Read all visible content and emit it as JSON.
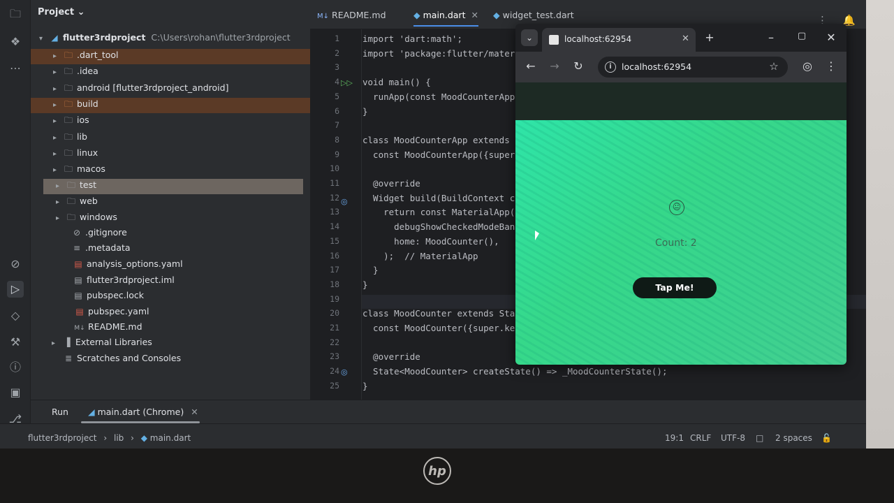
{
  "project_panel": {
    "title": "Project",
    "root": {
      "name": "flutter3rdproject",
      "path": "C:\\Users\\rohan\\flutter3rdproject"
    },
    "items": [
      {
        "label": ".dart_tool",
        "icon": "folder-excluded-icon"
      },
      {
        "label": ".idea",
        "icon": "folder-icon"
      },
      {
        "label": "android [flutter3rdproject_android]",
        "icon": "folder-icon"
      },
      {
        "label": "build",
        "icon": "folder-excluded-icon"
      },
      {
        "label": "ios",
        "icon": "folder-icon"
      },
      {
        "label": "lib",
        "icon": "folder-icon"
      },
      {
        "label": "linux",
        "icon": "folder-icon"
      },
      {
        "label": "macos",
        "icon": "folder-icon"
      },
      {
        "label": "test",
        "icon": "folder-icon"
      },
      {
        "label": "web",
        "icon": "folder-icon"
      },
      {
        "label": "windows",
        "icon": "folder-icon"
      },
      {
        "label": ".gitignore",
        "icon": "gitignore-icon"
      },
      {
        "label": ".metadata",
        "icon": "file-icon"
      },
      {
        "label": "analysis_options.yaml",
        "icon": "yaml-icon"
      },
      {
        "label": "flutter3rdproject.iml",
        "icon": "iml-icon"
      },
      {
        "label": "pubspec.lock",
        "icon": "file-icon"
      },
      {
        "label": "pubspec.yaml",
        "icon": "yaml-icon"
      },
      {
        "label": "README.md",
        "icon": "markdown-icon"
      },
      {
        "label": "External Libraries",
        "icon": "library-icon"
      },
      {
        "label": "Scratches and Consoles",
        "icon": "scratches-icon"
      }
    ]
  },
  "editor": {
    "tabs": [
      {
        "label": "README.md",
        "icon": "M↓"
      },
      {
        "label": "main.dart",
        "active": true
      },
      {
        "label": "widget_test.dart"
      }
    ],
    "line_numbers": [
      "1",
      "2",
      "3",
      "4",
      "5",
      "6",
      "7",
      "8",
      "9",
      "10",
      "11",
      "12",
      "13",
      "14",
      "15",
      "16",
      "17",
      "18",
      "19",
      "20",
      "21",
      "22",
      "23",
      "24",
      "25"
    ],
    "lines": [
      "import 'dart:math';",
      "import 'package:flutter/mater",
      "",
      "void main() {",
      "  runApp(const MoodCounterApp",
      "}",
      "",
      "class MoodCounterApp extends",
      "  const MoodCounterApp({super",
      "",
      "  @override",
      "  Widget build(BuildContext c",
      "    return const MaterialApp(",
      "      debugShowCheckedModeBan",
      "      home: MoodCounter(),",
      "    );  // MaterialApp",
      "  }",
      "}",
      "",
      "class MoodCounter extends Sta",
      "  const MoodCounter({super.ke",
      "",
      "  @override",
      "  State<MoodCounter> createState() => _MoodCounterState();",
      "}"
    ]
  },
  "run_bar": {
    "tool": "Run",
    "config": "main.dart (Chrome)"
  },
  "status_bar": {
    "breadcrumb": [
      "flutter3rdproject",
      "lib",
      "main.dart"
    ],
    "position": "19:1",
    "line_ending": "CRLF",
    "encoding": "UTF-8",
    "indent": "2 spaces"
  },
  "browser": {
    "tab_title": "localhost:62954",
    "url": "localhost:62954",
    "app": {
      "emoji": "😐",
      "count_text": "Count: 2",
      "button_label": "Tap Me!"
    }
  },
  "brand": {
    "logo_text": "hp"
  },
  "colors": {
    "accent": "#4a8ee8",
    "page_gradient_start": "#2fe4a8",
    "page_gradient_end": "#44cf90",
    "button": "#0f1a16"
  }
}
